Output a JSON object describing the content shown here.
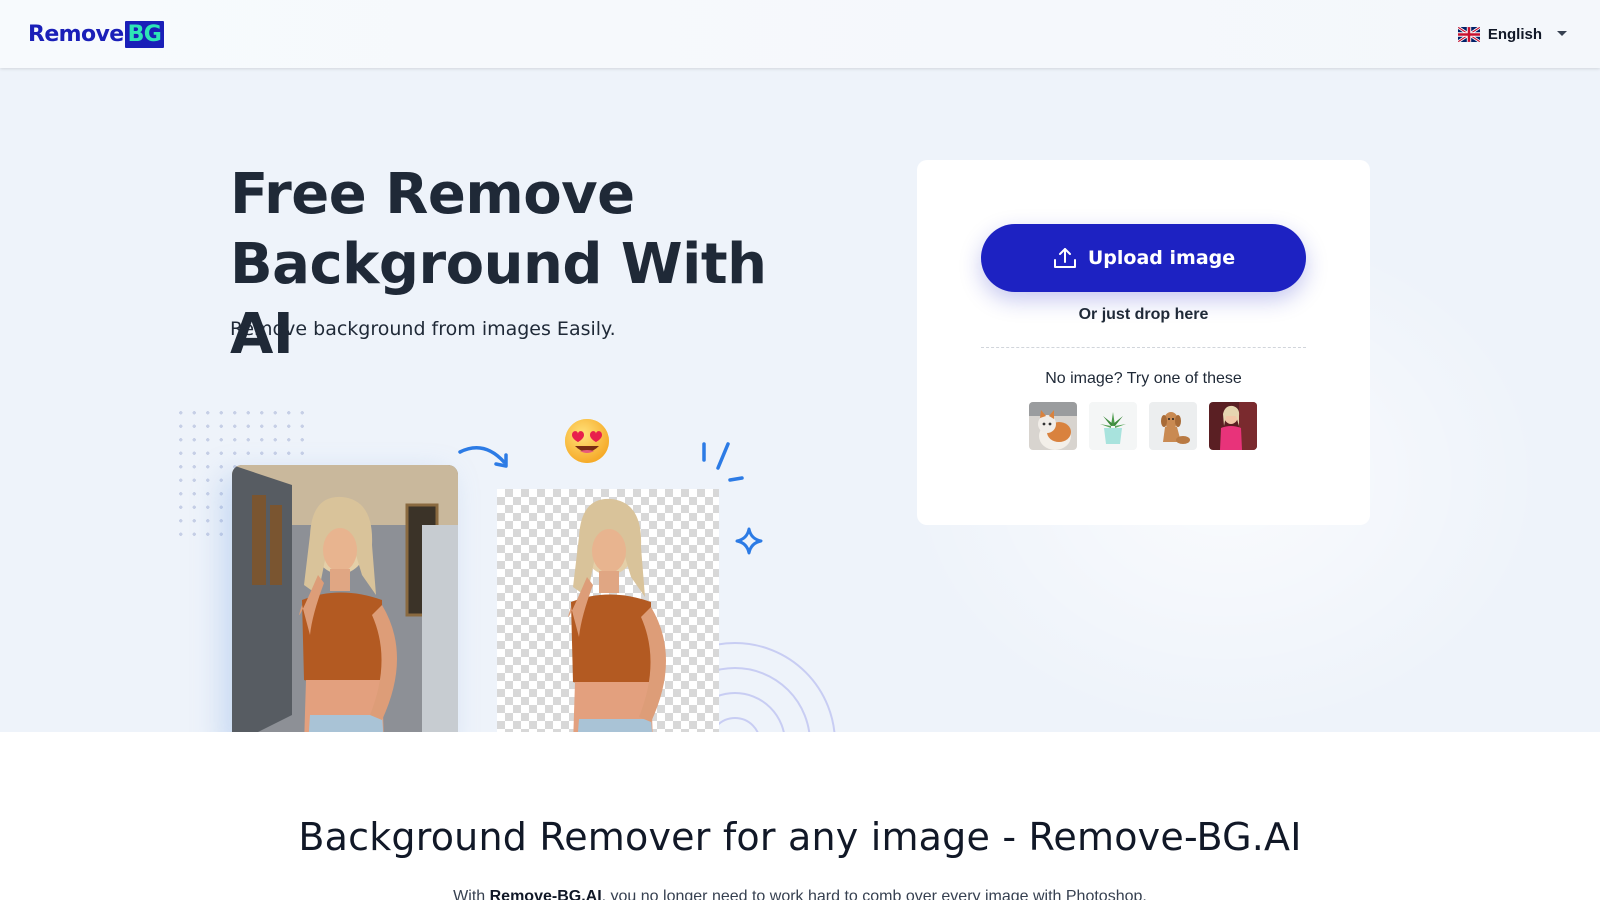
{
  "header": {
    "logo": {
      "text": "Remove",
      "badge": "BG"
    },
    "language": {
      "label": "English",
      "icon": "uk-flag-icon"
    }
  },
  "hero": {
    "title_line1": "Free Remove",
    "title_line2": "Background With AI",
    "subtitle": "Remove background from images Easily."
  },
  "upload_card": {
    "upload_label": "Upload image",
    "upload_icon": "upload-icon",
    "drop_text": "Or just drop here",
    "try_text": "No image? Try one of these",
    "samples": [
      "cat",
      "plant",
      "dog",
      "woman"
    ]
  },
  "section": {
    "title": "Background Remover for any image - Remove-BG.AI",
    "text_prefix": "With ",
    "text_brand": "Remove-BG.AI",
    "text_rest": ", you no longer need to work hard to comb over every image with Photoshop."
  },
  "colors": {
    "brand": "#1d22c2",
    "accent": "#2ee6b6",
    "hero_bg": "#eef3fa"
  }
}
